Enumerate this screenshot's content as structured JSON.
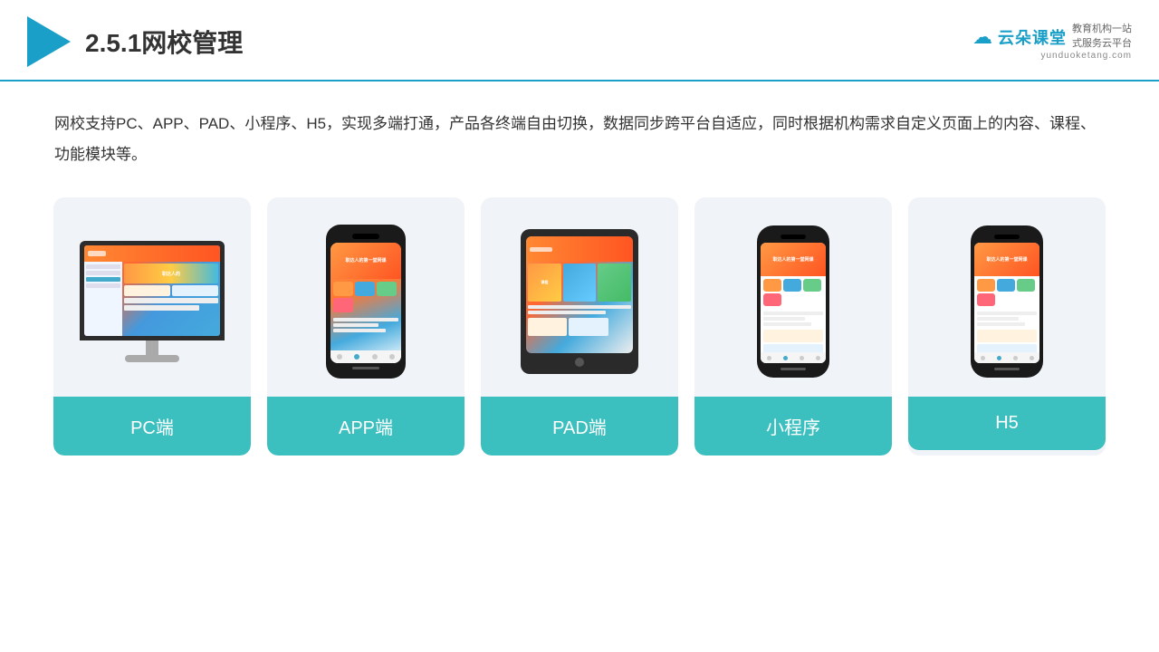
{
  "header": {
    "section_number": "2.5.1",
    "title": "网校管理",
    "brand": {
      "name": "云朵课堂",
      "url": "yunduoketang.com",
      "tagline_line1": "教育机构一站",
      "tagline_line2": "式服务云平台"
    }
  },
  "description": "网校支持PC、APP、PAD、小程序、H5，实现多端打通，产品各终端自由切换，数据同步跨平台自适应，同时根据机构需求自定义页面上的内容、课程、功能模块等。",
  "cards": [
    {
      "id": "pc",
      "label": "PC端"
    },
    {
      "id": "app",
      "label": "APP端"
    },
    {
      "id": "pad",
      "label": "PAD端"
    },
    {
      "id": "miniprogram",
      "label": "小程序"
    },
    {
      "id": "h5",
      "label": "H5"
    }
  ]
}
